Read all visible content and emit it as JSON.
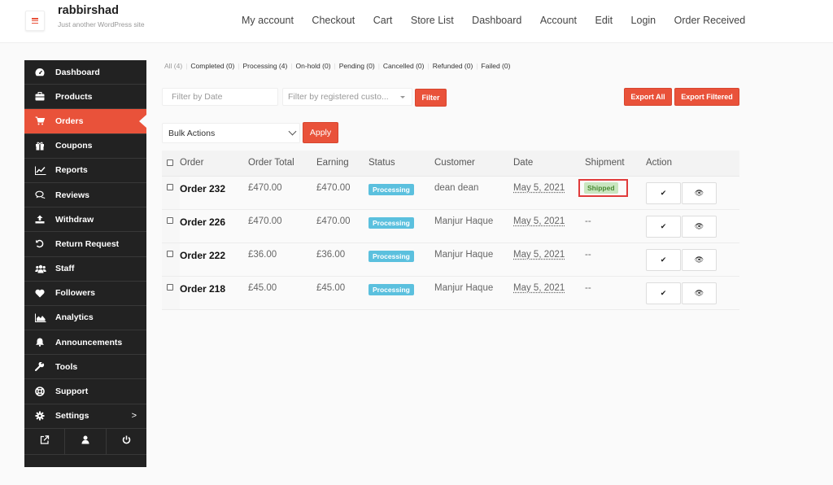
{
  "header": {
    "site_title": "rabbirshad",
    "site_description": "Just another WordPress site",
    "nav": [
      "My account",
      "Checkout",
      "Cart",
      "Store List",
      "Dashboard",
      "Account",
      "Edit",
      "Login",
      "Order Received"
    ]
  },
  "sidebar": {
    "items": [
      {
        "label": "Dashboard",
        "icon": "dashboard-icon"
      },
      {
        "label": "Products",
        "icon": "briefcase-icon"
      },
      {
        "label": "Orders",
        "icon": "cart-icon",
        "active": true
      },
      {
        "label": "Coupons",
        "icon": "gift-icon"
      },
      {
        "label": "Reports",
        "icon": "line-chart-icon"
      },
      {
        "label": "Reviews",
        "icon": "comments-icon"
      },
      {
        "label": "Withdraw",
        "icon": "upload-icon"
      },
      {
        "label": "Return Request",
        "icon": "undo-icon"
      },
      {
        "label": "Staff",
        "icon": "users-icon"
      },
      {
        "label": "Followers",
        "icon": "heart-icon"
      },
      {
        "label": "Analytics",
        "icon": "area-chart-icon"
      },
      {
        "label": "Announcements",
        "icon": "bell-icon"
      },
      {
        "label": "Tools",
        "icon": "wrench-icon"
      },
      {
        "label": "Support",
        "icon": "life-ring-icon"
      },
      {
        "label": "Settings",
        "icon": "gear-icon",
        "chevron": ">"
      }
    ],
    "bottom_icons": [
      "external-link-icon",
      "user-icon",
      "power-icon"
    ]
  },
  "status_filters": [
    {
      "label": "All (4)",
      "current": true
    },
    {
      "label": "Completed (0)"
    },
    {
      "label": "Processing (4)"
    },
    {
      "label": "On-hold (0)"
    },
    {
      "label": "Pending (0)"
    },
    {
      "label": "Cancelled (0)"
    },
    {
      "label": "Refunded (0)"
    },
    {
      "label": "Failed (0)"
    }
  ],
  "filters": {
    "date_placeholder": "Filter by Date",
    "customer_placeholder": "Filter by registered custo...",
    "filter_label": "Filter",
    "export_all_label": "Export All",
    "export_filtered_label": "Export Filtered",
    "bulk_actions_value": "Bulk Actions",
    "apply_label": "Apply"
  },
  "table": {
    "columns": [
      "Order",
      "Order Total",
      "Earning",
      "Status",
      "Customer",
      "Date",
      "Shipment",
      "Action"
    ],
    "rows": [
      {
        "order": "Order 232",
        "total": "£470.00",
        "earning": "£470.00",
        "status": "Processing",
        "customer": "dean dean",
        "date": "May 5, 2021",
        "shipment": "Shipped"
      },
      {
        "order": "Order 226",
        "total": "£470.00",
        "earning": "£470.00",
        "status": "Processing",
        "customer": "Manjur Haque",
        "date": "May 5, 2021",
        "shipment": "--"
      },
      {
        "order": "Order 222",
        "total": "£36.00",
        "earning": "£36.00",
        "status": "Processing",
        "customer": "Manjur Haque",
        "date": "May 5, 2021",
        "shipment": "--"
      },
      {
        "order": "Order 218",
        "total": "£45.00",
        "earning": "£45.00",
        "status": "Processing",
        "customer": "Manjur Haque",
        "date": "May 5, 2021",
        "shipment": "--"
      }
    ],
    "action_icons": [
      "check-icon",
      "eye-icon"
    ]
  },
  "colors": {
    "accent": "#e9523a",
    "sidebar_bg": "#222222",
    "processing_badge": "#5bc0de",
    "shipped_badge_bg": "#c9e6c0",
    "shipped_badge_text": "#4a8a34",
    "highlight_border": "#e03b3b"
  }
}
